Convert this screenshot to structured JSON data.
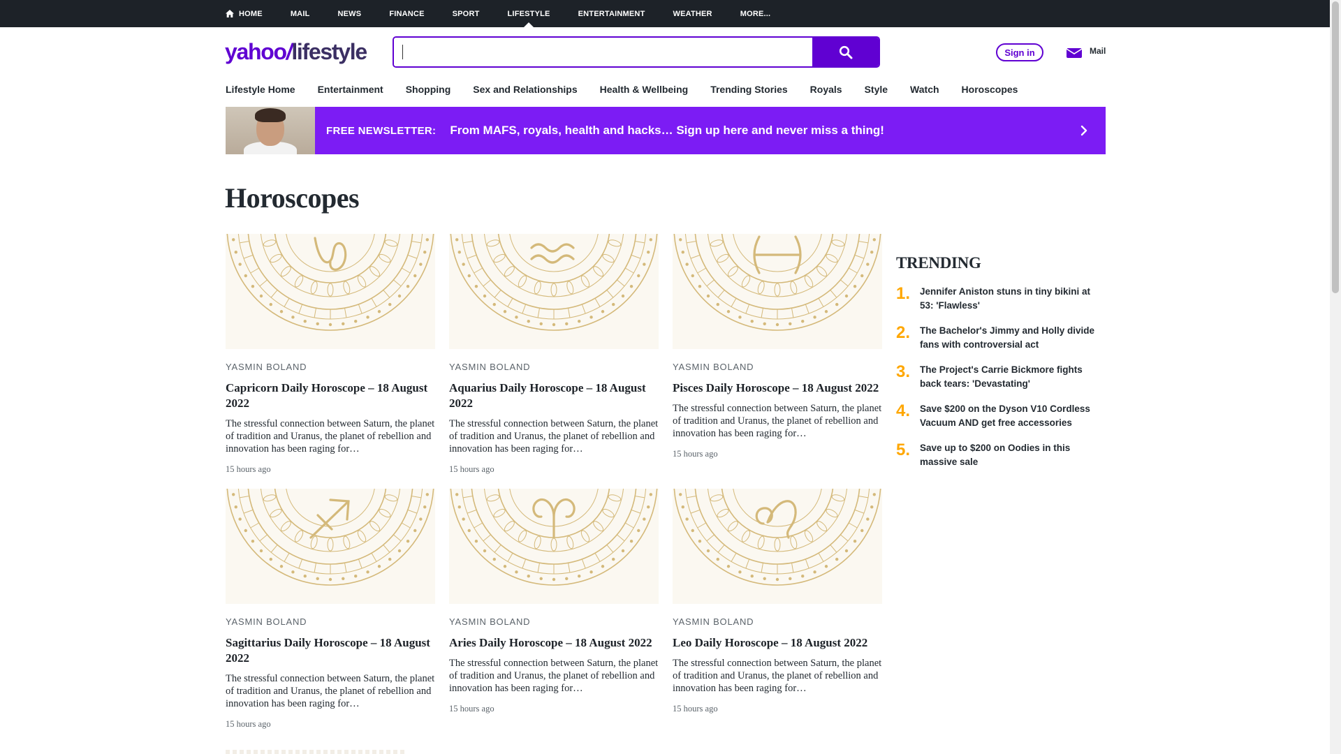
{
  "topnav": {
    "items": [
      "HOME",
      "MAIL",
      "NEWS",
      "FINANCE",
      "SPORT",
      "LIFESTYLE",
      "ENTERTAINMENT",
      "WEATHER",
      "MORE..."
    ],
    "active": "LIFESTYLE"
  },
  "header": {
    "logo_brand": "yahoo",
    "logo_slash": "/",
    "logo_section": "lifestyle",
    "search_value": "",
    "signin_label": "Sign in",
    "mail_label": "Mail"
  },
  "subnav": {
    "items": [
      "Lifestyle Home",
      "Entertainment",
      "Shopping",
      "Sex and Relationships",
      "Health & Wellbeing",
      "Trending Stories",
      "Royals",
      "Style",
      "Watch",
      "Horoscopes"
    ]
  },
  "newsletter": {
    "label": "FREE NEWSLETTER:",
    "message": "From MAFS, royals, health and hacks… Sign up here and never miss a thing!"
  },
  "page": {
    "title": "Horoscopes"
  },
  "cards": [
    {
      "author": "YASMIN BOLAND",
      "title": "Capricorn Daily Horoscope – 18 August 2022",
      "desc": "The stressful connection between Saturn, the planet of tradition and Uranus, the planet of rebellion and innovation has been raging for…",
      "time": "15 hours ago"
    },
    {
      "author": "YASMIN BOLAND",
      "title": "Aquarius Daily Horoscope – 18 August 2022",
      "desc": "The stressful connection between Saturn, the planet of tradition and Uranus, the planet of rebellion and innovation has been raging for…",
      "time": "15 hours ago"
    },
    {
      "author": "YASMIN BOLAND",
      "title": "Pisces Daily Horoscope – 18 August 2022",
      "desc": "The stressful connection between Saturn, the planet of tradition and Uranus, the planet of rebellion and innovation has been raging for…",
      "time": "15 hours ago"
    },
    {
      "author": "YASMIN BOLAND",
      "title": "Sagittarius Daily Horoscope – 18 August 2022",
      "desc": "The stressful connection between Saturn, the planet of tradition and Uranus, the planet of rebellion and innovation has been raging for…",
      "time": "15 hours ago"
    },
    {
      "author": "YASMIN BOLAND",
      "title": "Aries Daily Horoscope – 18 August 2022",
      "desc": "The stressful connection between Saturn, the planet of tradition and Uranus, the planet of rebellion and innovation has been raging for…",
      "time": "15 hours ago"
    },
    {
      "author": "YASMIN BOLAND",
      "title": "Leo Daily Horoscope – 18 August 2022",
      "desc": "The stressful connection between Saturn, the planet of tradition and Uranus, the planet of rebellion and innovation has been raging for…",
      "time": "15 hours ago"
    }
  ],
  "trending": {
    "heading": "TRENDING",
    "items": [
      {
        "num": "1.",
        "text": "Jennifer Aniston stuns in tiny bikini at 53: 'Flawless'"
      },
      {
        "num": "2.",
        "text": "The Bachelor's Jimmy and Holly divide fans with controversial act"
      },
      {
        "num": "3.",
        "text": "The Project's Carrie Bickmore fights back tears: 'Devastating'"
      },
      {
        "num": "4.",
        "text": "Save $200 on the Dyson V10 Cordless Vacuum AND get free accessories"
      },
      {
        "num": "5.",
        "text": "Save up to $200 on Oodies in this massive sale"
      }
    ]
  },
  "colors": {
    "brand_purple": "#6001d2",
    "newsletter_bg": "#7c1cf4",
    "trending_number": "#ffa700",
    "topbar_bg": "#1d2228",
    "gold_art": "#d4b97a"
  },
  "icons": {
    "home": "home-icon",
    "search": "search-icon",
    "mail": "mail-icon",
    "chevron": "chevron-right-icon"
  }
}
